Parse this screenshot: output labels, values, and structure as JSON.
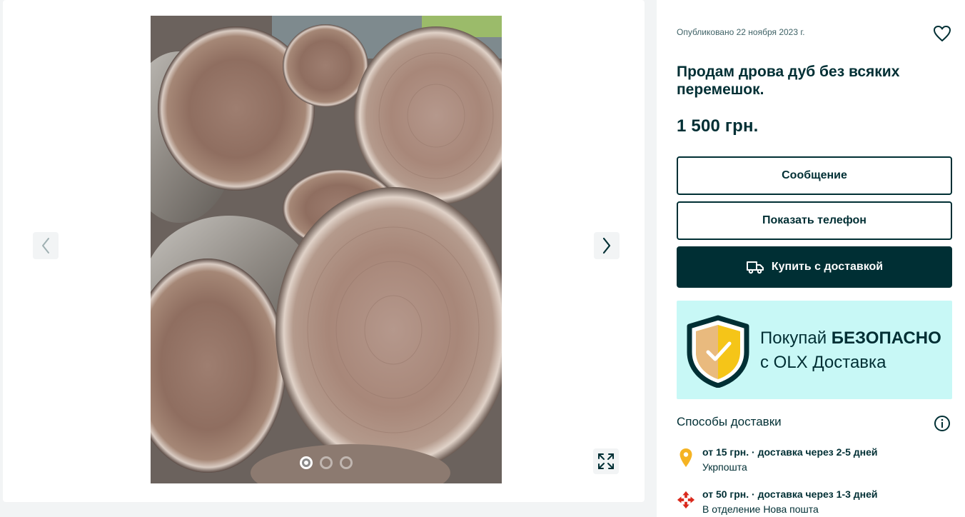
{
  "gallery": {
    "photo_alt": "oak firewood log cross-sections",
    "prev_icon": "chevron-left-icon",
    "next_icon": "chevron-right-icon",
    "fullscreen_icon": "expand-icon",
    "dots_count": 3,
    "active_dot": 0
  },
  "listing": {
    "published": "Опубликовано 22 ноября 2023 г.",
    "title": "Продам дрова дуб без всяких перемешок.",
    "price": "1 500 грн."
  },
  "actions": {
    "message_label": "Сообщение",
    "phone_label": "Показать телефон",
    "buy_label": "Купить с доставкой"
  },
  "banner": {
    "line1_prefix": "Покупай ",
    "line1_bold": "БЕЗОПАСНО",
    "line2": "с OLX Доставка"
  },
  "delivery": {
    "heading": "Способы доставки",
    "options": [
      {
        "main": "от 15 грн. · доставка через 2-5 дней",
        "sub": "Укрпошта",
        "icon": "map-pin-icon"
      },
      {
        "main": "от 50 грн. · доставка через 1-3 дней",
        "sub": "В отделение Нова пошта",
        "icon": "nova-poshta-logo-icon"
      }
    ]
  },
  "colors": {
    "brand_dark": "#002f34",
    "banner_bg": "#c8f8f6",
    "shield_gold": "#f5c518",
    "nova_red": "#da291c",
    "pin_yellow": "#f5b323"
  }
}
